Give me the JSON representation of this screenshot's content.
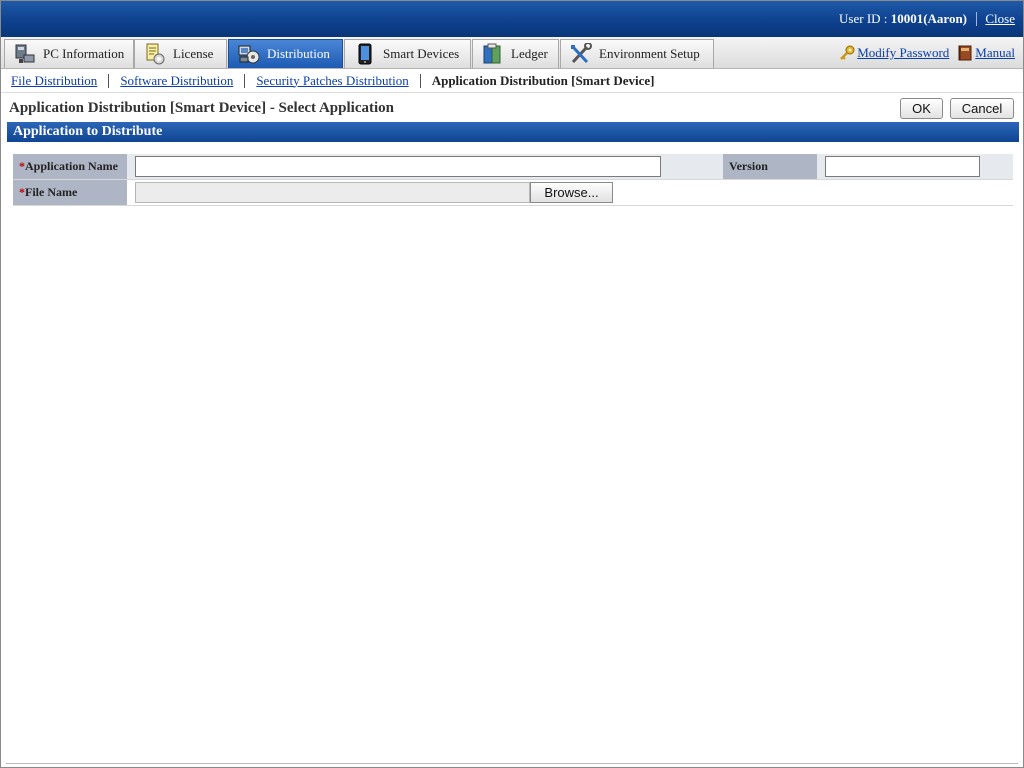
{
  "header": {
    "user_label": "User ID : ",
    "user_value": "10001(Aaron)",
    "close_label": "Close"
  },
  "tabs": [
    {
      "label": "PC Information",
      "icon": "pc-icon"
    },
    {
      "label": "License",
      "icon": "license-icon"
    },
    {
      "label": "Distribution",
      "icon": "distribution-icon",
      "active": true
    },
    {
      "label": "Smart Devices",
      "icon": "smartphone-icon"
    },
    {
      "label": "Ledger",
      "icon": "ledger-icon"
    },
    {
      "label": "Environment Setup",
      "icon": "tools-icon"
    }
  ],
  "tab_links": {
    "modify_password": "Modify Password",
    "manual": "Manual"
  },
  "subnav": {
    "items": [
      "File Distribution",
      "Software Distribution",
      "Security Patches Distribution"
    ],
    "current": "Application Distribution [Smart Device]"
  },
  "page": {
    "title": "Application Distribution [Smart Device] - Select Application",
    "ok_label": "OK",
    "cancel_label": "Cancel"
  },
  "section": {
    "title": "Application to Distribute"
  },
  "form": {
    "required_mark": "*",
    "app_name_label": "Application Name",
    "app_name_value": "",
    "version_label": "Version",
    "version_value": "",
    "file_name_label": "File Name",
    "browse_label": "Browse..."
  },
  "colors": {
    "header_blue": "#0c3f8c",
    "active_tab": "#1d5bb4",
    "section_blue": "#0f4592",
    "label_bg": "#aeb6c5",
    "link": "#0b3fa8"
  }
}
